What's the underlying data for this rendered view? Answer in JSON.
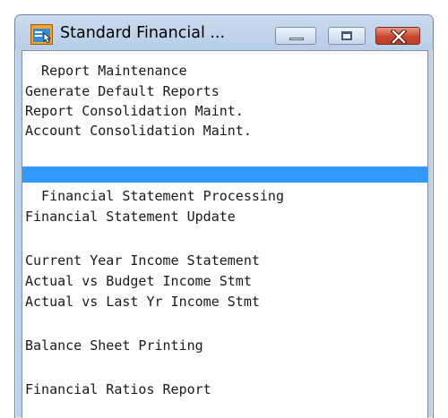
{
  "window": {
    "title": "Standard Financial ..."
  },
  "menu": {
    "items": [
      "  Report Maintenance",
      "Generate Default Reports",
      "Report Consolidation Maint.",
      "Account Consolidation Maint.",
      "",
      "  Financial Statement Processing",
      "Financial Statement Update",
      "",
      "Current Year Income Statement",
      "Actual vs Budget Income Stmt",
      "Actual vs Last Yr Income Stmt",
      "",
      "Balance Sheet Printing",
      "",
      "Financial Ratios Report"
    ],
    "selected_index": 4,
    "selection_color": "#3399ff"
  },
  "icons": {
    "app": "app-window-icon",
    "minimize": "minimize-icon",
    "maximize": "maximize-icon",
    "close": "close-icon"
  }
}
